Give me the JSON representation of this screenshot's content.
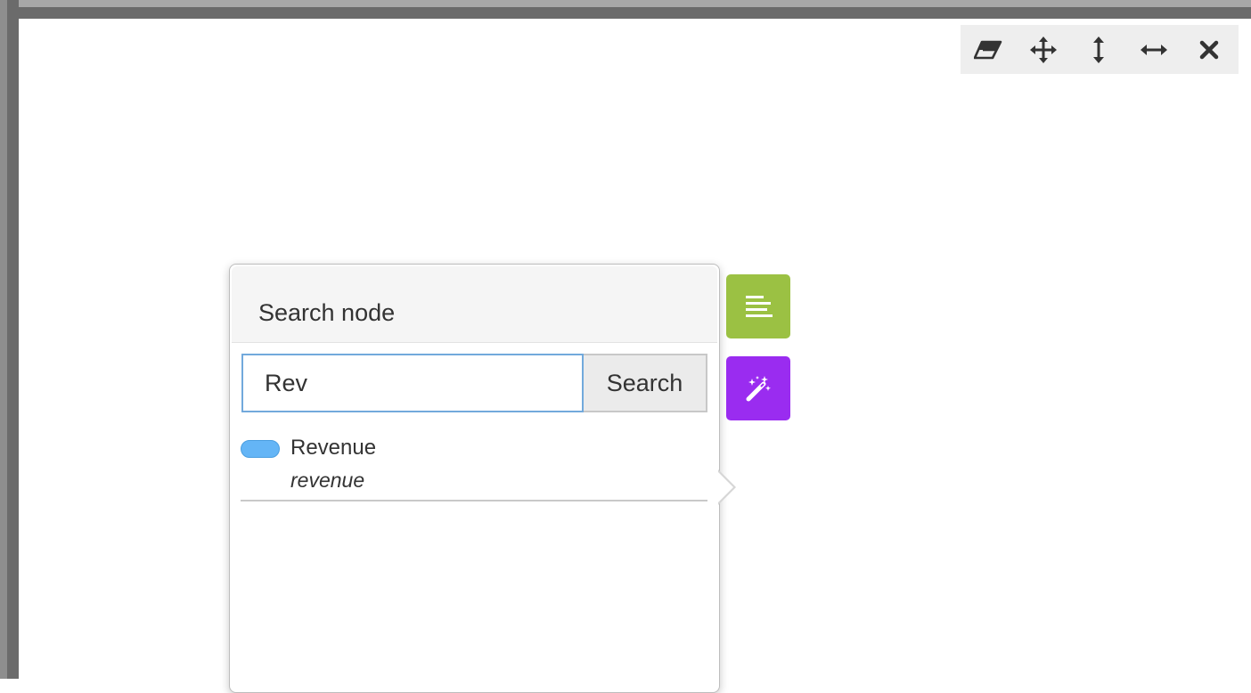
{
  "toolbar": {
    "buttons": [
      {
        "icon": "eraser-icon"
      },
      {
        "icon": "move-icon"
      },
      {
        "icon": "resize-vertical-icon"
      },
      {
        "icon": "resize-horizontal-icon"
      },
      {
        "icon": "close-icon"
      }
    ]
  },
  "popover": {
    "title": "Search node",
    "search_value": "Rev",
    "search_button_label": "Search",
    "results": [
      {
        "label": "Revenue",
        "key": "revenue",
        "color": "#64b5f6"
      }
    ]
  },
  "side_buttons": [
    {
      "icon": "align-left-icon",
      "color": "#9bc143"
    },
    {
      "icon": "magic-wand-icon",
      "color": "#9a2cf0"
    }
  ]
}
